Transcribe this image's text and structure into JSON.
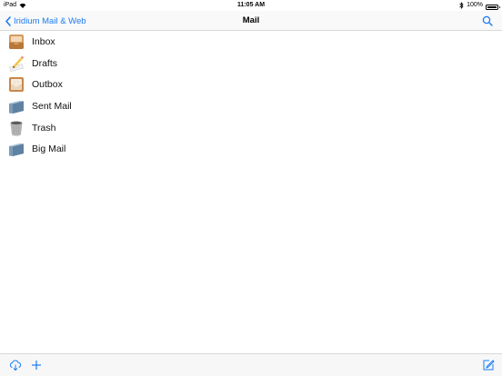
{
  "status_bar": {
    "device": "iPad",
    "time": "11:05 AM",
    "battery": "100%"
  },
  "nav": {
    "back_label": "Iridium Mail & Web",
    "title": "Mail"
  },
  "mailboxes": [
    {
      "label": "Inbox",
      "icon": "inbox-tray-icon"
    },
    {
      "label": "Drafts",
      "icon": "drafts-pencil-icon"
    },
    {
      "label": "Outbox",
      "icon": "outbox-tray-icon"
    },
    {
      "label": "Sent Mail",
      "icon": "folder-icon"
    },
    {
      "label": "Trash",
      "icon": "trash-can-icon"
    },
    {
      "label": "Big Mail",
      "icon": "folder-icon"
    }
  ],
  "toolbar": {
    "left_icons": [
      "cloud-refresh-icon",
      "plus-icon"
    ],
    "right_icon": "compose-icon"
  },
  "colors": {
    "accent": "#1a7cf5",
    "navbar_bg": "#f9f9f9"
  }
}
